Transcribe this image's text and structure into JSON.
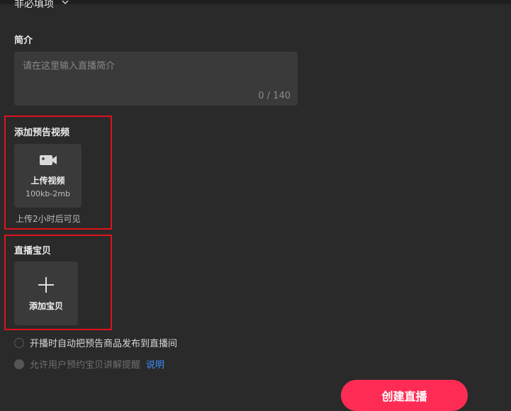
{
  "optional_section": {
    "label": "非必填项"
  },
  "intro": {
    "label": "简介",
    "placeholder": "请在这里输入直播简介",
    "counter": "0 / 140"
  },
  "preview_video": {
    "label": "添加预告视频",
    "upload_title": "上传视频",
    "upload_size": "100kb-2mb",
    "hint": "上传2小时后可见"
  },
  "live_items": {
    "label": "直播宝贝",
    "add_label": "添加宝贝"
  },
  "options": {
    "auto_publish": "开播时自动把预告商品发布到直播间",
    "allow_reserve": "允许用户预约宝贝讲解提醒",
    "explain_link": "说明"
  },
  "create_button": {
    "label": "创建直播"
  },
  "colors": {
    "accent": "#fe2c55",
    "highlight": "#e0121c",
    "link": "#3d8cff"
  }
}
